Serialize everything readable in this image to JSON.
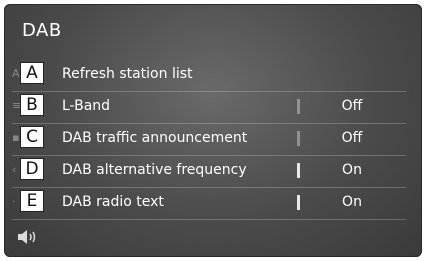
{
  "header": {
    "title": "DAB"
  },
  "items": [
    {
      "callout": "A",
      "label": "Refresh station list",
      "value": "",
      "icon": "edge-partial-icon"
    },
    {
      "callout": "B",
      "label": "L-Band",
      "value": "Off",
      "icon": "edge-menu-icon"
    },
    {
      "callout": "C",
      "label": "DAB traffic announcement",
      "value": "Off",
      "icon": "edge-square-icon"
    },
    {
      "callout": "D",
      "label": "DAB alternative frequency",
      "value": "On",
      "icon": "edge-arrow-icon"
    },
    {
      "callout": "E",
      "label": "DAB radio text",
      "value": "On",
      "icon": "edge-dot-icon"
    }
  ],
  "footer": {
    "icon": "speaker-volume-icon"
  }
}
